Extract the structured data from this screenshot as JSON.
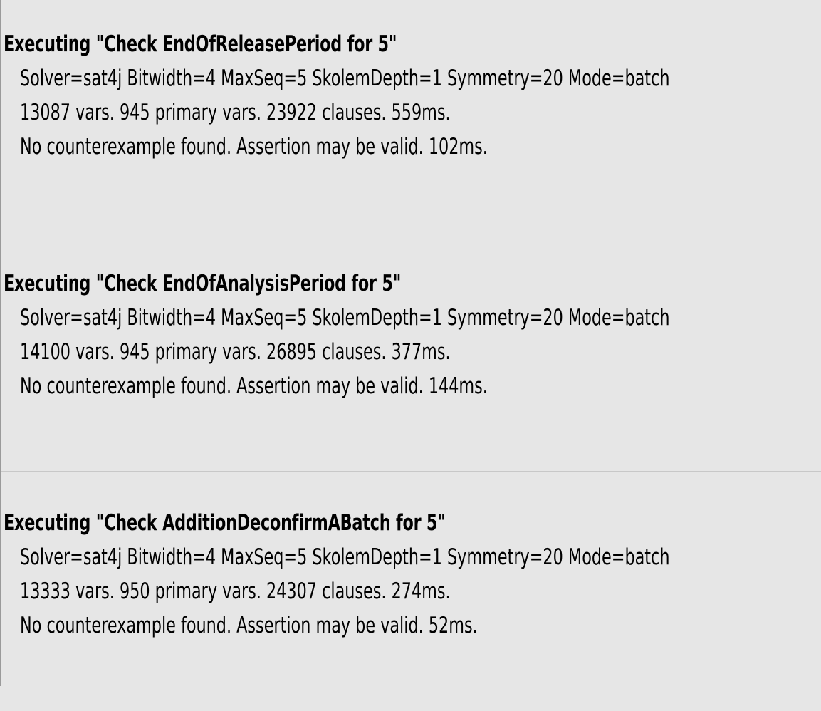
{
  "log": {
    "entries": [
      {
        "executing": "Executing \"Check EndOfReleasePeriod for 5\"",
        "solver": "Solver=sat4j Bitwidth=4 MaxSeq=5 SkolemDepth=1 Symmetry=20 Mode=batch",
        "stats": "13087 vars. 945 primary vars. 23922 clauses. 559ms.",
        "result": "No counterexample found. Assertion may be valid. 102ms."
      },
      {
        "executing": "Executing \"Check EndOfAnalysisPeriod for 5\"",
        "solver": "Solver=sat4j Bitwidth=4 MaxSeq=5 SkolemDepth=1 Symmetry=20 Mode=batch",
        "stats": "14100 vars. 945 primary vars. 26895 clauses. 377ms.",
        "result": "No counterexample found. Assertion may be valid. 144ms."
      },
      {
        "executing": "Executing \"Check AdditionDeconfirmABatch for 5\"",
        "solver": "Solver=sat4j Bitwidth=4 MaxSeq=5 SkolemDepth=1 Symmetry=20 Mode=batch",
        "stats": "13333 vars. 950 primary vars. 24307 clauses. 274ms.",
        "result": "No counterexample found. Assertion may be valid. 52ms."
      }
    ]
  }
}
